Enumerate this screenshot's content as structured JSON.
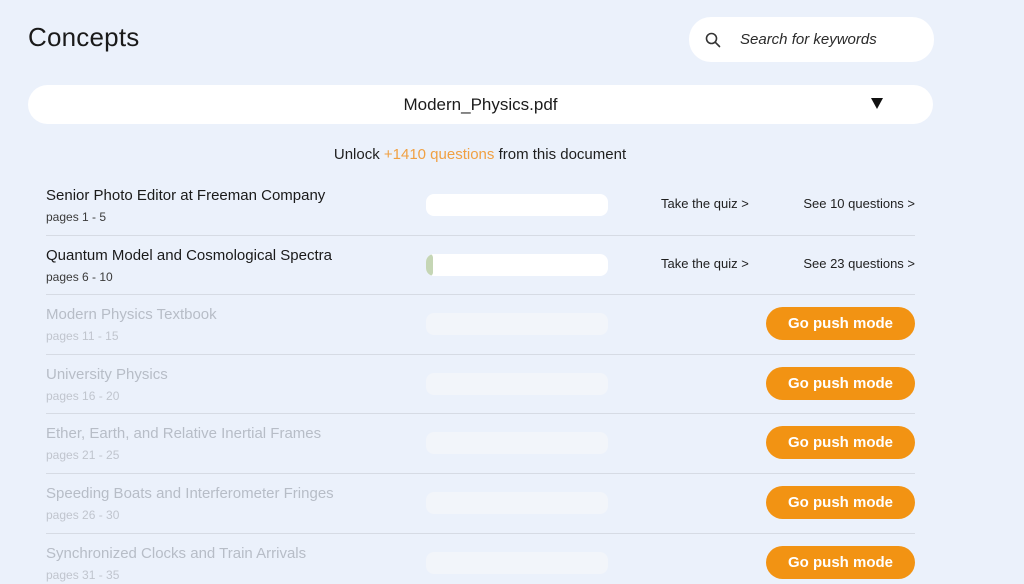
{
  "header": {
    "title": "Concepts"
  },
  "search": {
    "placeholder": "Search for keywords",
    "icon": "search-icon"
  },
  "document_select": {
    "selected": "Modern_Physics.pdf",
    "icon": "caret-down-icon"
  },
  "unlock": {
    "prefix": "Unlock ",
    "count": "+1410 questions",
    "suffix": " from this document"
  },
  "colors": {
    "accent": "#f0a042",
    "button": "#f29313",
    "progress": "#c5d6b5",
    "background": "#ebf1fb"
  },
  "concepts": [
    {
      "name": "Senior Photo Editor at Freeman Company",
      "pages": "pages 1 - 5",
      "locked": false,
      "progress": 0,
      "quiz_label": "Take the quiz >",
      "questions_label": "See 10 questions >"
    },
    {
      "name": "Quantum Model and Cosmological Spectra",
      "pages": "pages 6 - 10",
      "locked": false,
      "progress": 0.03,
      "quiz_label": "Take the quiz >",
      "questions_label": "See 23 questions >"
    },
    {
      "name": "Modern Physics Textbook",
      "pages": "pages 11 - 15",
      "locked": true,
      "progress": 0,
      "button_label": "Go push mode"
    },
    {
      "name": "University Physics",
      "pages": "pages 16 - 20",
      "locked": true,
      "progress": 0,
      "button_label": "Go push mode"
    },
    {
      "name": "Ether, Earth, and Relative Inertial Frames",
      "pages": "pages 21 - 25",
      "locked": true,
      "progress": 0,
      "button_label": "Go push mode"
    },
    {
      "name": "Speeding Boats and Interferometer Fringes",
      "pages": "pages 26 - 30",
      "locked": true,
      "progress": 0,
      "button_label": "Go push mode"
    },
    {
      "name": "Synchronized Clocks and Train Arrivals",
      "pages": "pages 31 - 35",
      "locked": true,
      "progress": 0,
      "button_label": "Go push mode"
    }
  ]
}
